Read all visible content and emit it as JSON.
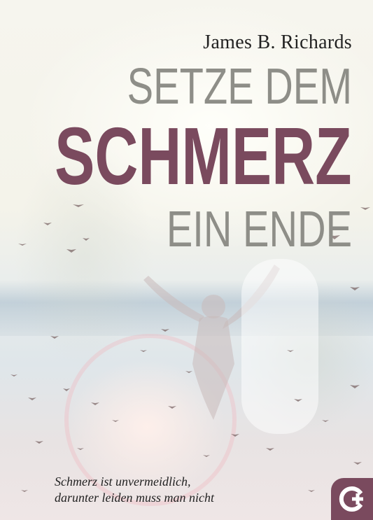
{
  "cover": {
    "author": "James B. Richards",
    "title_line1": "SETZE DEM",
    "title_line2": "SCHMERZ",
    "title_line3": "EIN ENDE",
    "tagline_line1": "Schmerz ist unvermeidlich,",
    "tagline_line2": "darunter leiden muss man nicht",
    "publisher_logo": "gerth-medien-logo"
  },
  "colors": {
    "title_gray": "#8e8e88",
    "title_accent": "#7a4a5e",
    "logo_bg": "#7a4a5e",
    "text_dark": "#222222"
  }
}
